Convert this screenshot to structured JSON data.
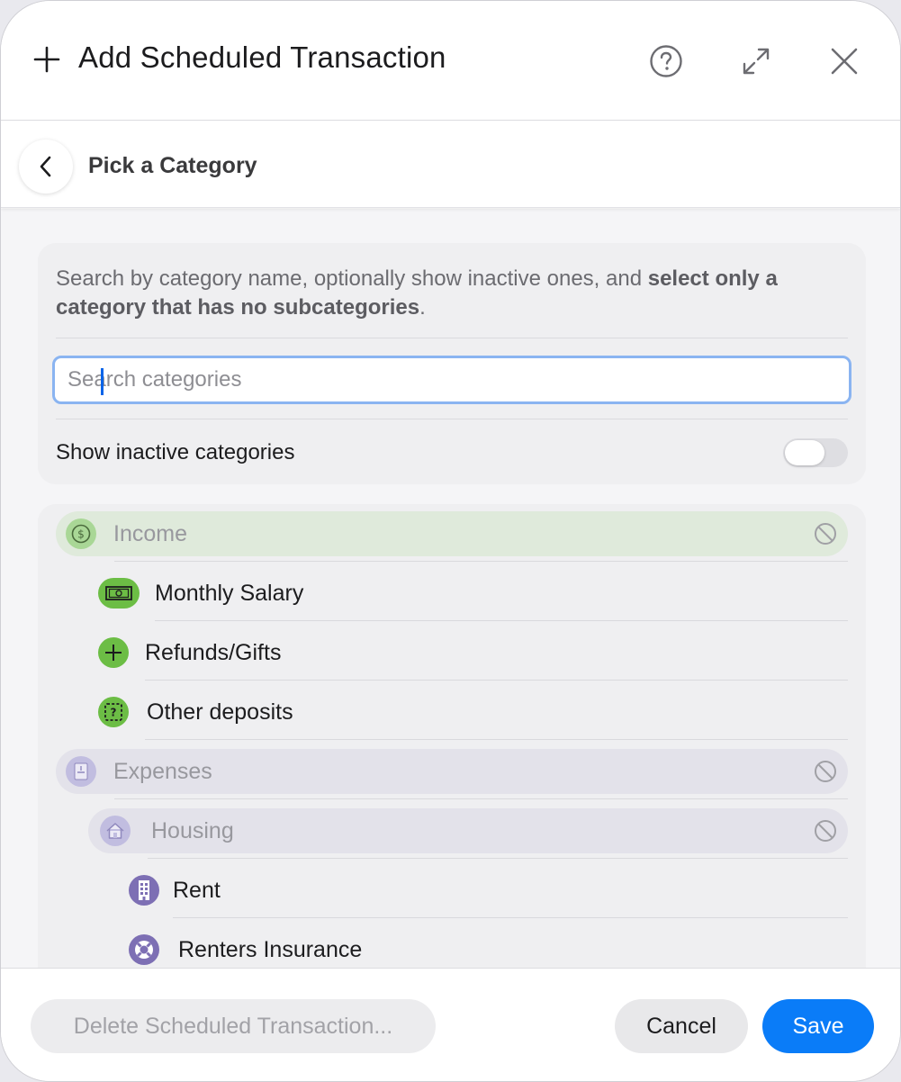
{
  "header": {
    "title": "Add Scheduled Transaction",
    "help_icon": "question-circle-icon",
    "expand_icon": "expand-arrows-icon",
    "close_icon": "close-icon"
  },
  "subheader": {
    "title": "Pick a Category",
    "back_icon": "chevron-left-icon"
  },
  "filter": {
    "description_plain": "Search by category name, optionally show inactive ones, and ",
    "description_bold": "select only a category that has no subcategories",
    "description_end": ".",
    "search_placeholder": "Search categories",
    "search_value": "",
    "show_inactive_label": "Show inactive categories",
    "show_inactive_on": false
  },
  "categories": {
    "income": {
      "label": "Income",
      "icon": "dollar-circle-icon",
      "color": "#8fcf6f"
    },
    "monthly_salary": {
      "label": "Monthly Salary",
      "icon": "banknote-icon",
      "color": "#6cbd45"
    },
    "refunds_gifts": {
      "label": "Refunds/Gifts",
      "icon": "plus-icon",
      "color": "#6cbd45"
    },
    "other_deposits": {
      "label": "Other deposits",
      "icon": "question-square-icon",
      "color": "#6cbd45"
    },
    "expenses": {
      "label": "Expenses",
      "icon": "receipt-icon",
      "color": "#b8b3d6"
    },
    "housing": {
      "label": "Housing",
      "icon": "house-icon",
      "color": "#b8b3d6"
    },
    "rent": {
      "label": "Rent",
      "icon": "building-icon",
      "color": "#7d6fb4"
    },
    "renters_insurance": {
      "label": "Renters Insurance",
      "icon": "lifebuoy-icon",
      "color": "#7d6fb4"
    }
  },
  "footer": {
    "delete_label": "Delete Scheduled Transaction...",
    "cancel_label": "Cancel",
    "save_label": "Save"
  },
  "colors": {
    "accent": "#0a7cf8",
    "focus_ring": "#8ab4f1"
  }
}
